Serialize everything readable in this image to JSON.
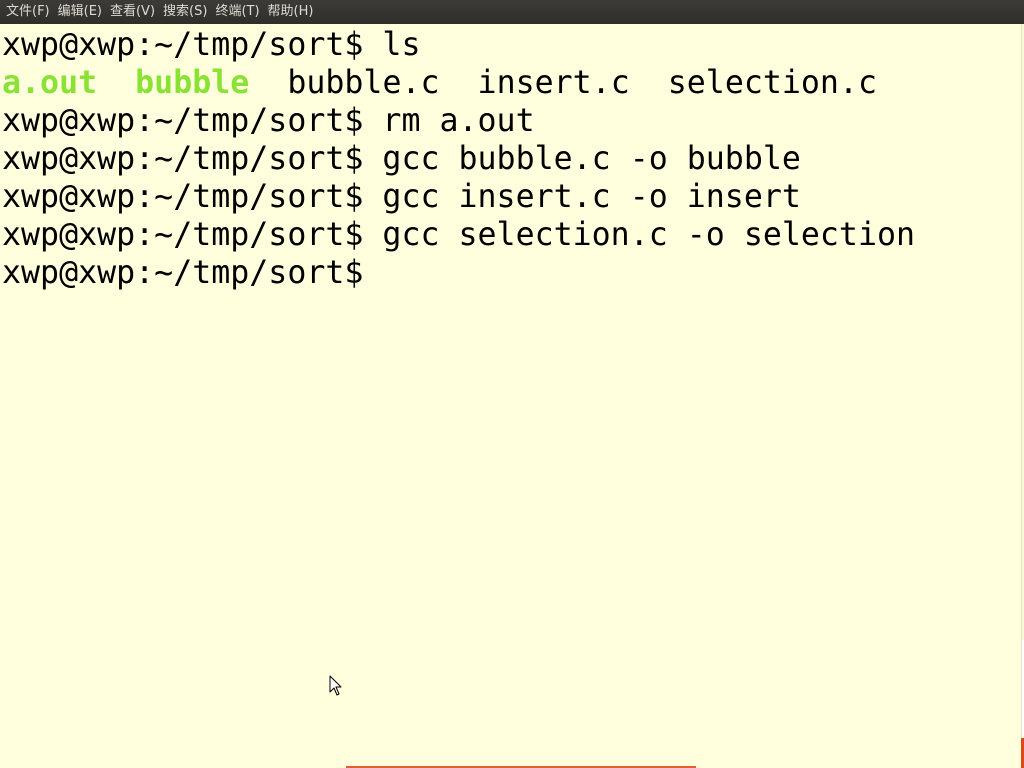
{
  "menubar": {
    "items": [
      "文件(F)",
      "编辑(E)",
      "查看(V)",
      "搜索(S)",
      "终端(T)",
      "帮助(H)"
    ]
  },
  "terminal": {
    "lines": [
      {
        "prompt": "xwp@xwp:~/tmp/sort$",
        "command": " ls"
      },
      {
        "exec1": "a.out",
        "sep1": "  ",
        "exec2": "bubble",
        "rest": "  bubble.c  insert.c  selection.c"
      },
      {
        "prompt": "xwp@xwp:~/tmp/sort$",
        "command": " rm a.out"
      },
      {
        "prompt": "xwp@xwp:~/tmp/sort$",
        "command": " gcc bubble.c -o bubble"
      },
      {
        "prompt": "xwp@xwp:~/tmp/sort$",
        "command": " gcc insert.c -o insert"
      },
      {
        "prompt": "xwp@xwp:~/tmp/sort$",
        "command": " gcc selection.c -o selection"
      },
      {
        "prompt": "xwp@xwp:~/tmp/sort$",
        "command": ""
      }
    ]
  },
  "colors": {
    "background": "#ffffdd",
    "text": "#000000",
    "executable": "#8ae234",
    "menubar": "#3c3b37",
    "menubar_text": "#dfdbd2"
  },
  "icons": {
    "mouse_cursor": "arrow-pointer-icon"
  }
}
